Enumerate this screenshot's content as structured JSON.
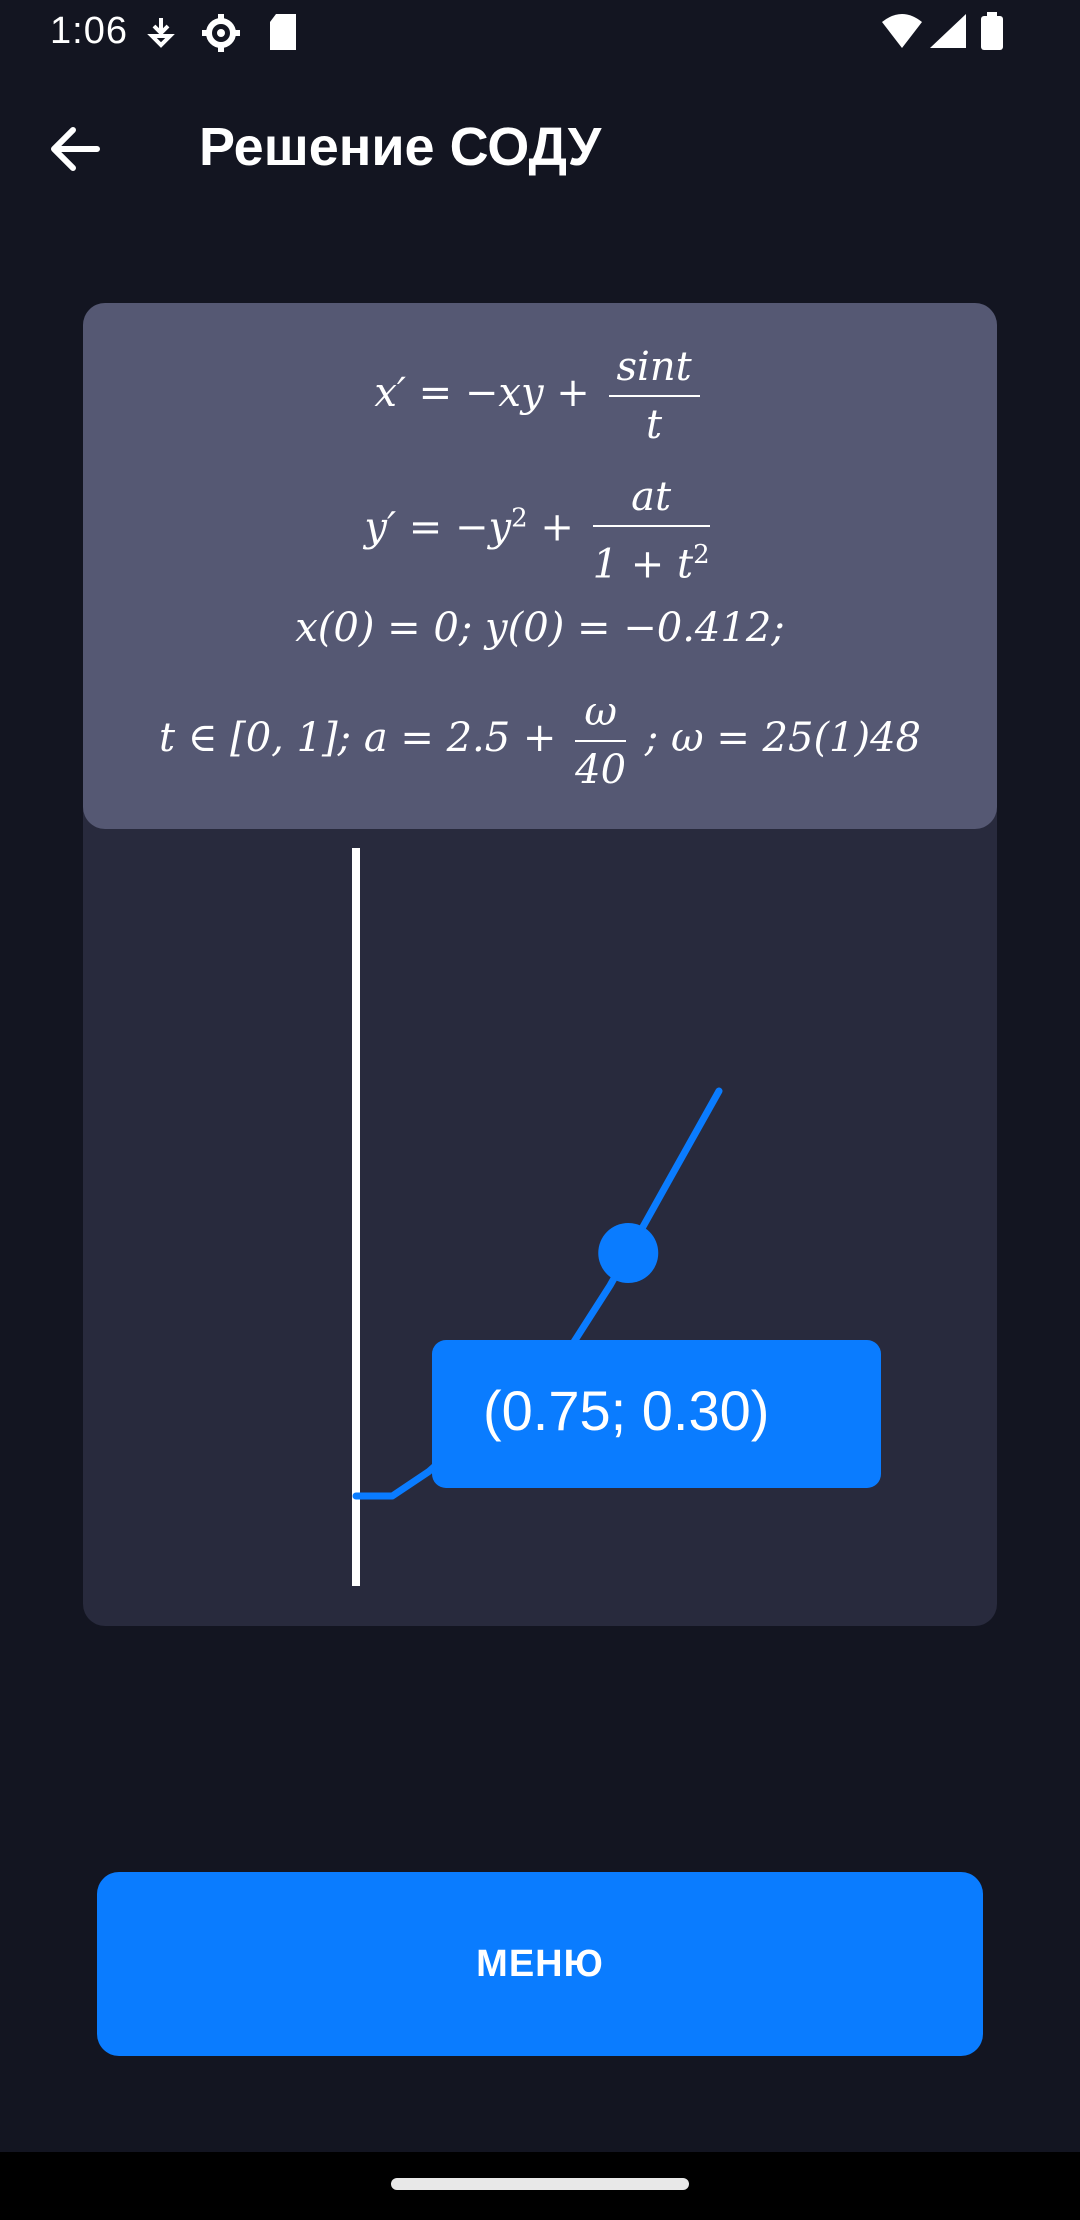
{
  "status_bar": {
    "time": "1:06",
    "icons": [
      "download-icon",
      "settings-icon",
      "sd-card-icon",
      "wifi-icon",
      "signal-icon",
      "battery-icon"
    ]
  },
  "app_bar": {
    "back_icon": "arrow-left-icon",
    "title": "Решение СОДУ"
  },
  "equations": {
    "eq1": {
      "lhs": "x′ = −xy + ",
      "num": "sint",
      "den": "t"
    },
    "eq2": {
      "lhs": "y′ = −y",
      "sup": "2",
      "mid": " + ",
      "num": "at",
      "den_base": "1 + t",
      "den_sup": "2"
    },
    "eq3": "x(0) = 0; y(0) = −0.412;",
    "eq4": {
      "lhs": "t ∈ [0, 1]; a = 2.5 + ",
      "num": "ω",
      "den": "40",
      "rhs": " ; ω = 25(1)48"
    }
  },
  "chart_data": {
    "type": "line",
    "series": [
      {
        "points": [
          [
            0.0,
            -0.0
          ],
          [
            0.1,
            0.0
          ],
          [
            0.2,
            0.03
          ],
          [
            0.3,
            0.07
          ],
          [
            0.4,
            0.1
          ],
          [
            0.5,
            0.14
          ],
          [
            0.6,
            0.19
          ],
          [
            0.7,
            0.26
          ],
          [
            0.75,
            0.3
          ],
          [
            0.85,
            0.38
          ],
          [
            1.0,
            0.5
          ]
        ]
      }
    ],
    "highlighted_point": [
      0.75,
      0.3
    ],
    "tooltip": "(0.75; 0.30)",
    "xlim": [
      0,
      1
    ],
    "ylim": [
      -0.12,
      0.8
    ],
    "colors": {
      "line": "#0a7cff",
      "axis": "#ffffff",
      "tooltip_bg": "#0a7cff"
    }
  },
  "menu_button": {
    "label": "МЕНЮ"
  }
}
